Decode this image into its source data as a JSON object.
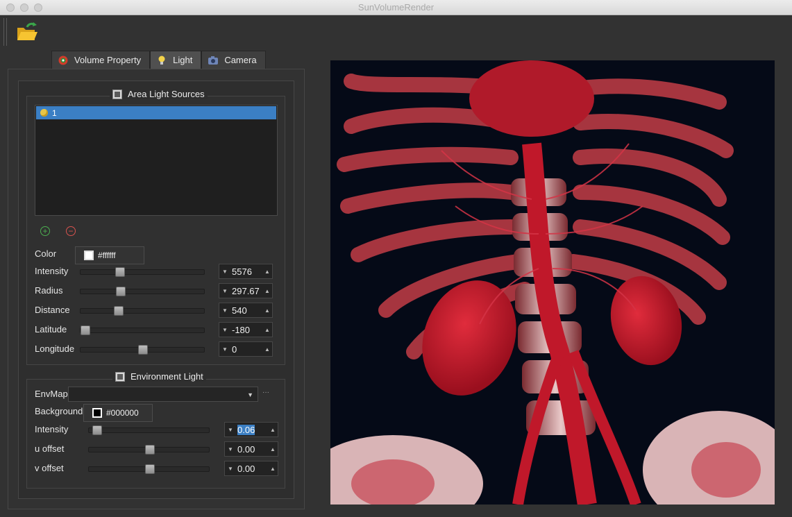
{
  "window": {
    "title": "SunVolumeRender"
  },
  "toolbar": {
    "open_icon": "folder-open-icon"
  },
  "tabs": [
    {
      "label": "Volume Property",
      "icon": "volume-property-icon",
      "active": false
    },
    {
      "label": "Light",
      "icon": "lightbulb-icon",
      "active": true
    },
    {
      "label": "Camera",
      "icon": "camera-icon",
      "active": false
    }
  ],
  "area_light": {
    "title": "Area Light Sources",
    "list": [
      {
        "label": "1",
        "icon": "light-bulb-icon"
      }
    ],
    "add_icon": "add-circle-icon",
    "remove_icon": "remove-circle-icon",
    "color": {
      "label": "Color",
      "value": "#ffffff"
    },
    "sliders": [
      {
        "label": "Intensity",
        "value": "5576",
        "level": 0.3
      },
      {
        "label": "Radius",
        "value": "297.67",
        "level": 0.31
      },
      {
        "label": "Distance",
        "value": "540",
        "level": 0.29
      },
      {
        "label": "Latitude",
        "value": "-180",
        "level": 0.0
      },
      {
        "label": "Longitude",
        "value": "0",
        "level": 0.5
      }
    ]
  },
  "environment_light": {
    "title": "Environment Light",
    "envmap": {
      "label": "EnvMap",
      "value": ""
    },
    "background": {
      "label": "Background",
      "value": "#000000"
    },
    "sliders": [
      {
        "label": "Intensity",
        "value": "0.06",
        "level": 0.03,
        "selected": true
      },
      {
        "label": "u offset",
        "value": "0.00",
        "level": 0.5
      },
      {
        "label": "v offset",
        "value": "0.00",
        "level": 0.5
      }
    ]
  },
  "render": {
    "description_icon": "volume-render-view"
  },
  "colors": {
    "accent": "#3b7fc4",
    "render_bg": "#050a17",
    "tissue": "#c0182a"
  }
}
